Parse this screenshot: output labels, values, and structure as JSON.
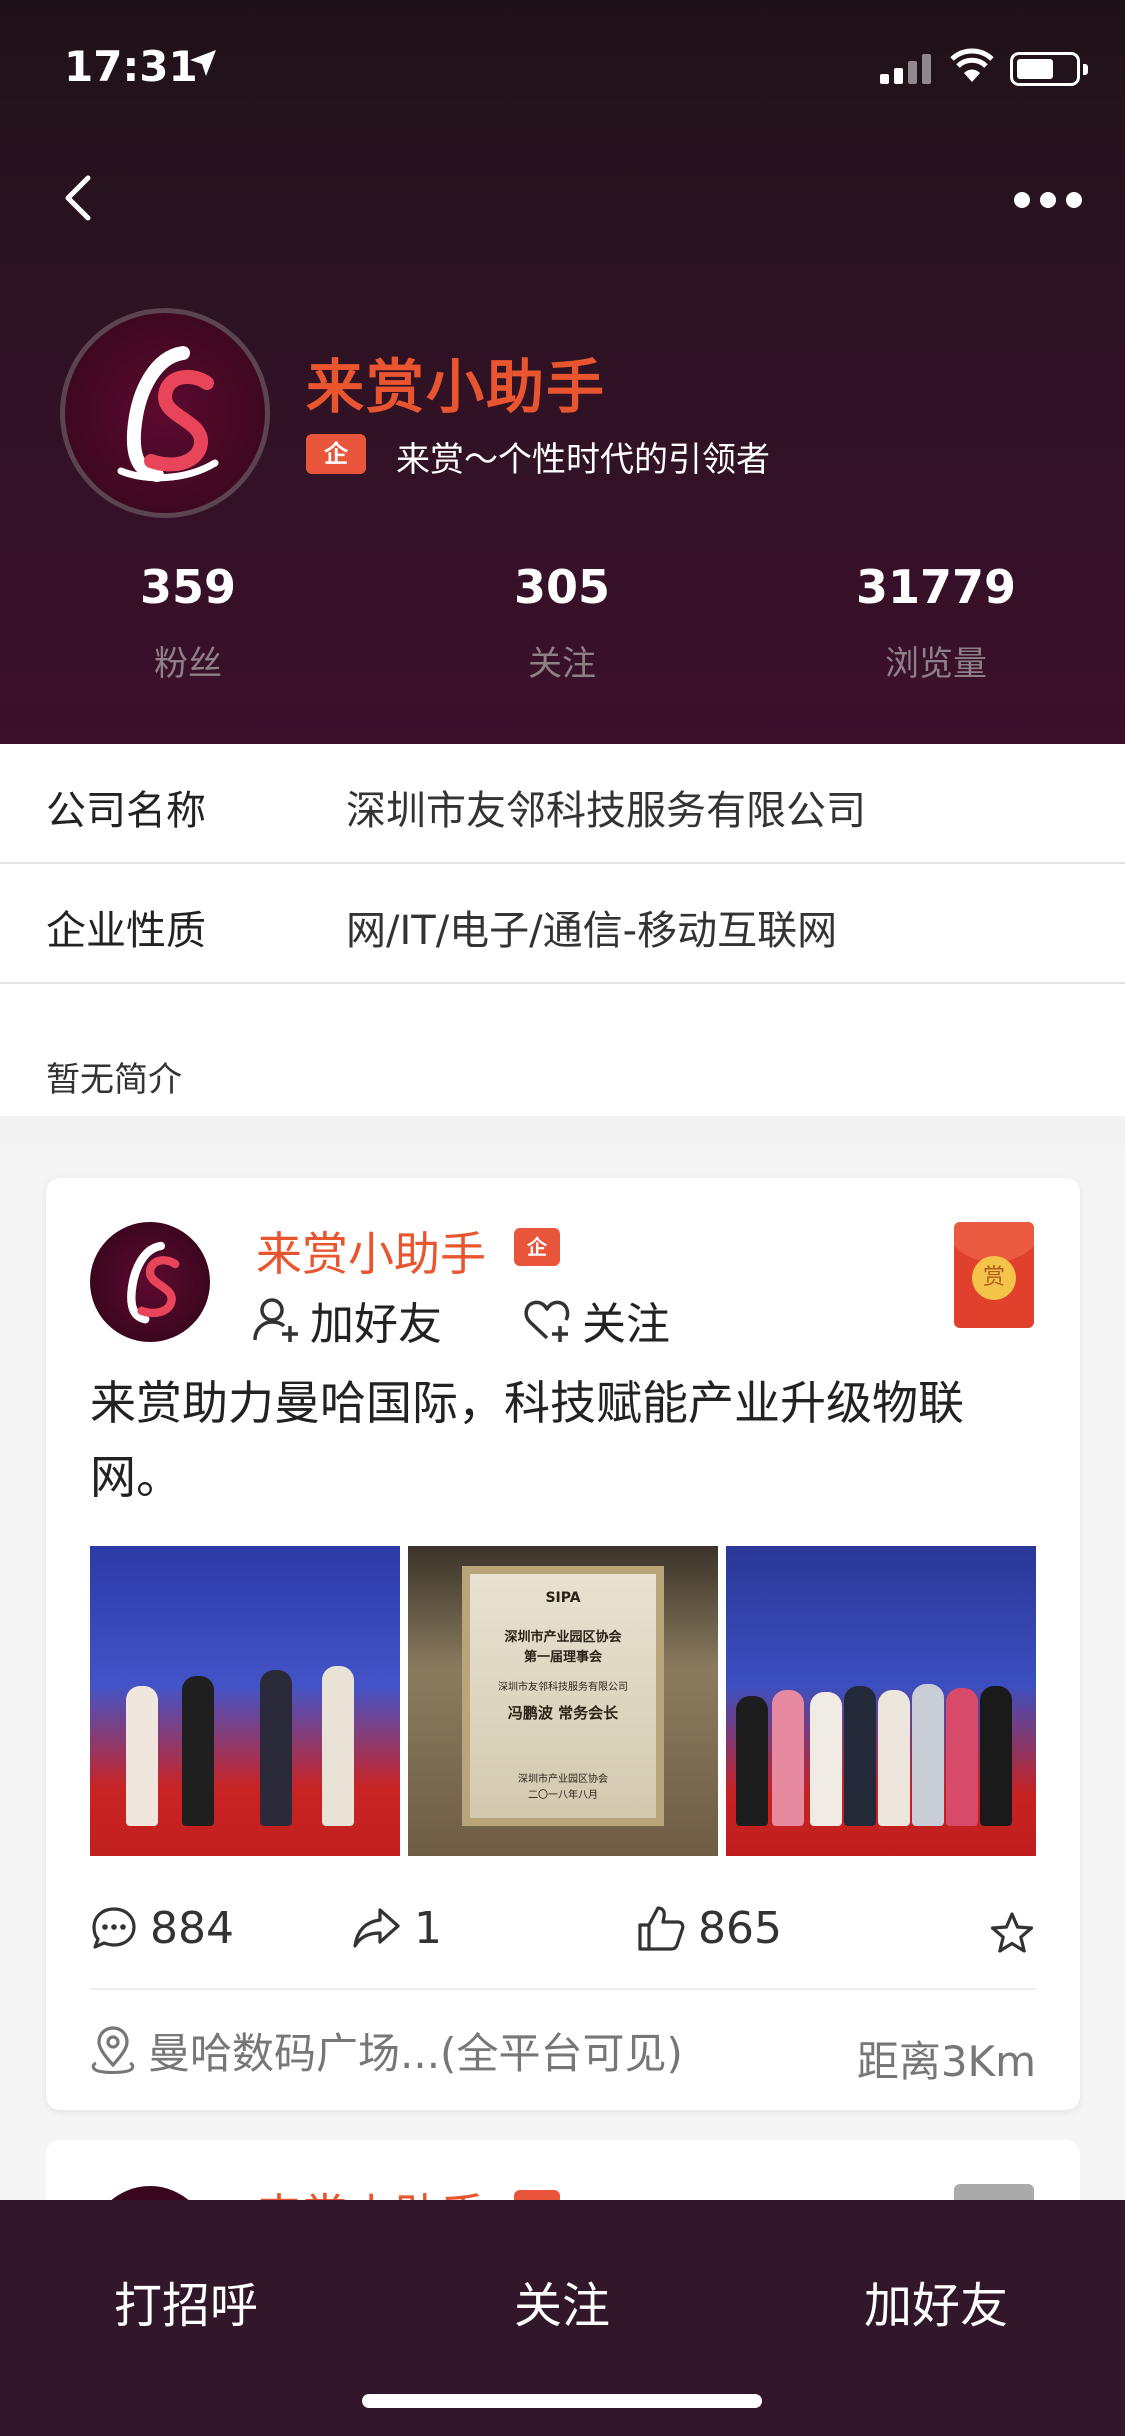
{
  "status_bar": {
    "time": "17:31"
  },
  "profile": {
    "name": "来赏小助手",
    "badge": "企",
    "tagline": "来赏～个性时代的引领者",
    "logo_text": "LS"
  },
  "stats": [
    {
      "value": "359",
      "label": "粉丝"
    },
    {
      "value": "305",
      "label": "关注"
    },
    {
      "value": "31779",
      "label": "浏览量"
    }
  ],
  "info": [
    {
      "key": "公司名称",
      "value": "深圳市友邻科技服务有限公司"
    },
    {
      "key": "企业性质",
      "value": "网/IT/电子/通信-移动互联网"
    }
  ],
  "intro": "暂无简介",
  "post": {
    "author": "来赏小助手",
    "badge": "企",
    "add_friend_label": "加好友",
    "follow_label": "关注",
    "red_packet_label": "赏",
    "text": "来赏助力曼哈国际，科技赋能产业升级物联网。",
    "plaque": {
      "org": "SIPA",
      "line1": "深圳市产业园区协会",
      "line2": "第一届理事会",
      "line3": "深圳市友邻科技服务有限公司",
      "line4": "冯鹏波  常务会长",
      "line5": "深圳市产业园区协会",
      "line6": "二〇一八年八月"
    },
    "comments": "884",
    "shares": "1",
    "likes": "865",
    "location": "曼哈数码广场...(全平台可见)",
    "distance": "距离3Km"
  },
  "next_post": {
    "author": "来赏小助手"
  },
  "bottom_bar": {
    "greet": "打招呼",
    "follow": "关注",
    "add_friend": "加好友"
  },
  "colors": {
    "accent": "#e8552f",
    "header_bg": "#2c1322",
    "bottom_bar_bg": "#32172a"
  }
}
